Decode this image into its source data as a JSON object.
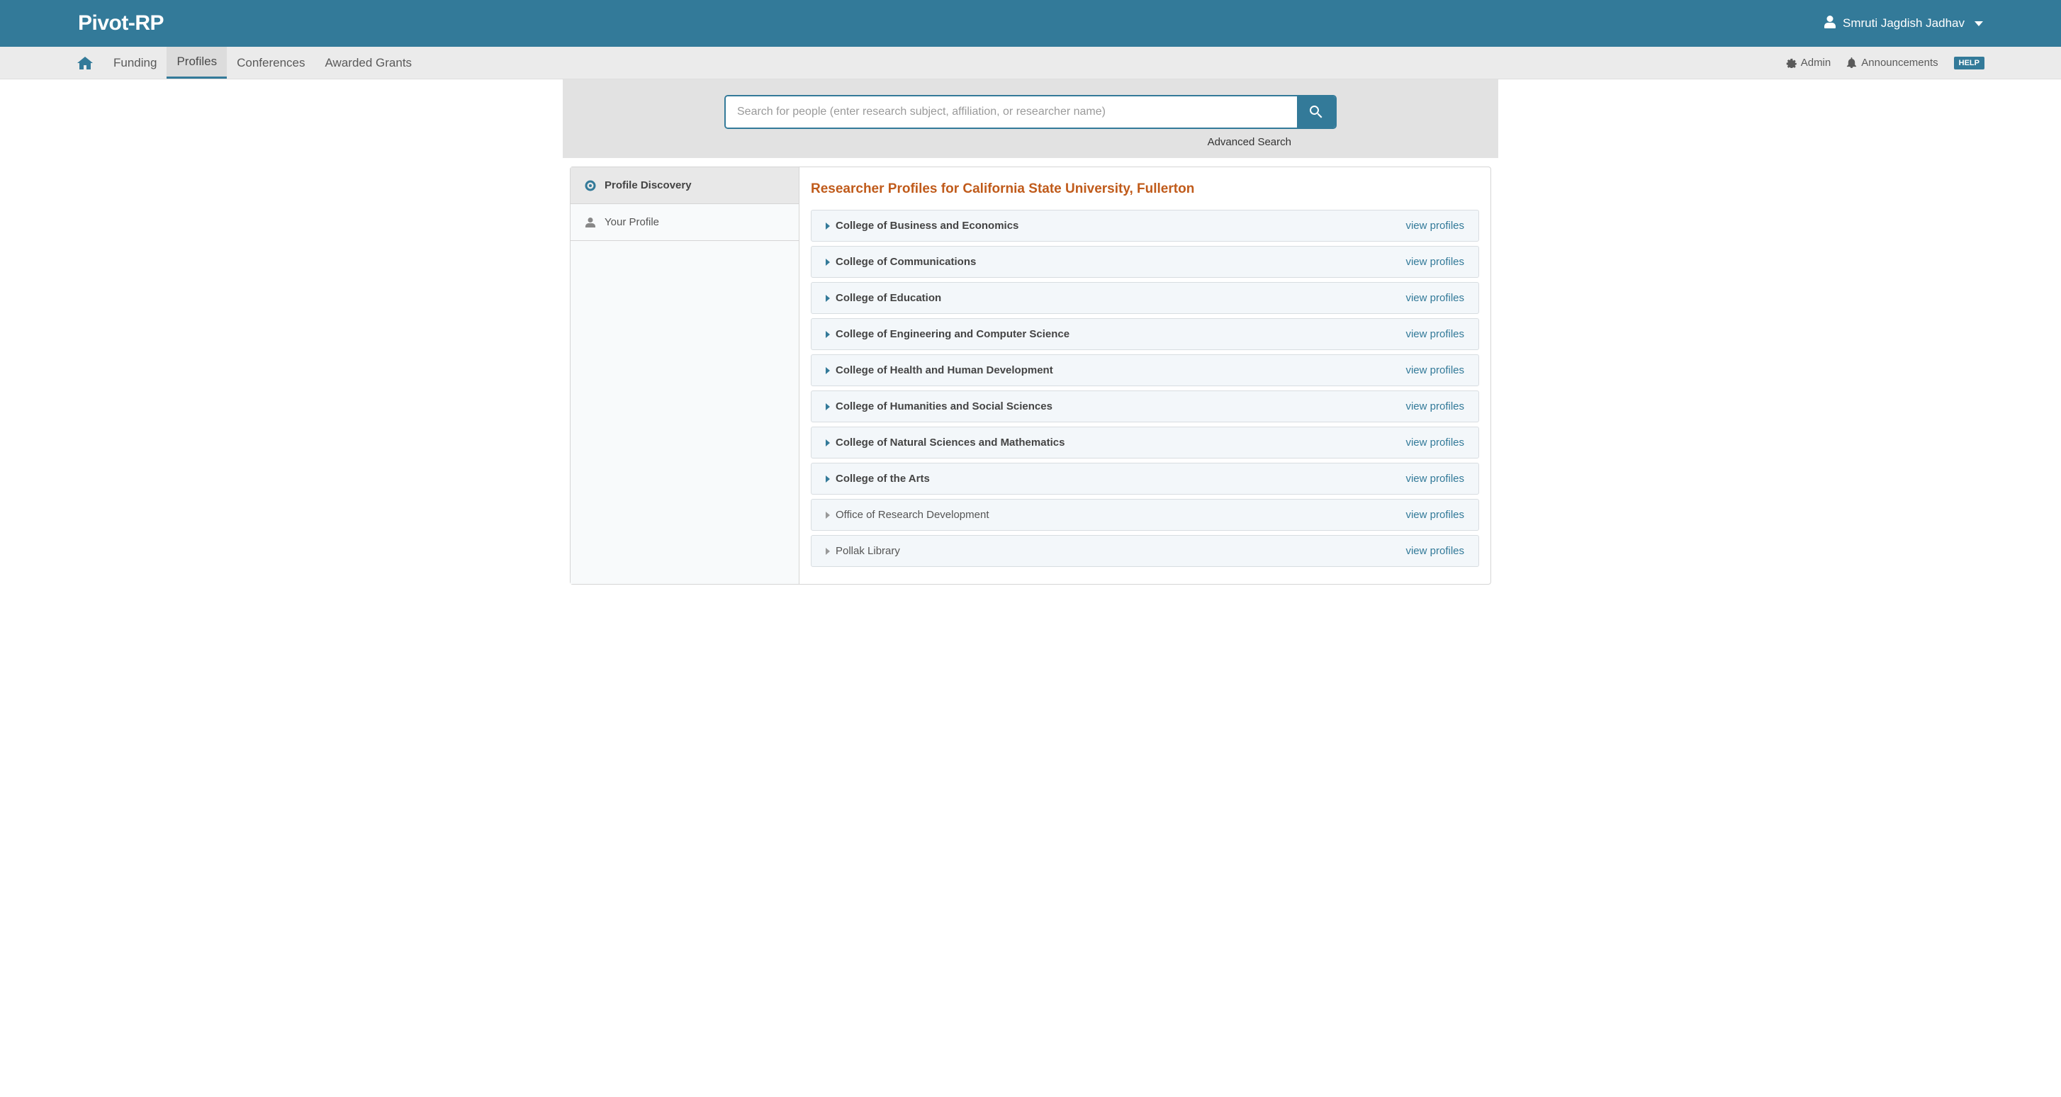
{
  "header": {
    "logo": "Pivot-RP",
    "username": "Smruti Jagdish Jadhav"
  },
  "nav": {
    "items": [
      {
        "label": "Funding"
      },
      {
        "label": "Profiles"
      },
      {
        "label": "Conferences"
      },
      {
        "label": "Awarded Grants"
      }
    ],
    "admin": "Admin",
    "announcements": "Announcements",
    "help": "HELP"
  },
  "search": {
    "placeholder": "Search for people (enter research subject, affiliation, or researcher name)",
    "advanced": "Advanced Search"
  },
  "sidebar": {
    "items": [
      {
        "label": "Profile Discovery"
      },
      {
        "label": "Your Profile"
      }
    ]
  },
  "main": {
    "title": "Researcher Profiles for California State University, Fullerton",
    "view_label": "view profiles",
    "colleges": [
      {
        "name": "College of Business and Economics",
        "bold": true
      },
      {
        "name": "College of Communications",
        "bold": true
      },
      {
        "name": "College of Education",
        "bold": true
      },
      {
        "name": "College of Engineering and Computer Science",
        "bold": true
      },
      {
        "name": "College of Health and Human Development",
        "bold": true
      },
      {
        "name": "College of Humanities and Social Sciences",
        "bold": true
      },
      {
        "name": "College of Natural Sciences and Mathematics",
        "bold": true
      },
      {
        "name": "College of the Arts",
        "bold": true
      },
      {
        "name": "Office of Research Development",
        "bold": false
      },
      {
        "name": "Pollak Library",
        "bold": false
      }
    ]
  }
}
